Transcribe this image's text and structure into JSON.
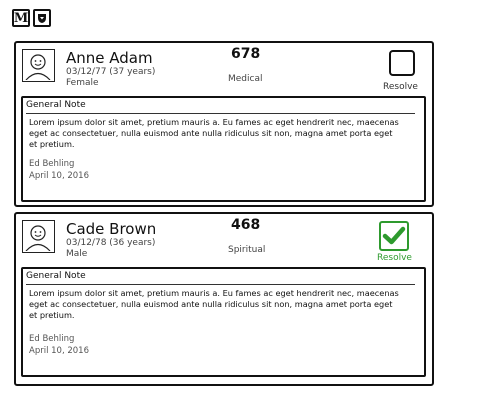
{
  "toolbar": {
    "m_label": "M",
    "icons": [
      "m-logo-icon",
      "shield-down-icon"
    ]
  },
  "patients": [
    {
      "name": "Anne Adam",
      "dob": "03/12/77 (37 years)",
      "gender": "Female",
      "score": "678",
      "category": "Medical",
      "resolve_label": "Resolve",
      "resolved": false,
      "note": {
        "title": "General Note",
        "body": "Lorem ipsum dolor sit amet, pretium mauris a. Eu fames ac eget hendrerit nec, maecenas eget ac consectetuer, nulla euismod ante nulla ridiculus sit non, magna amet porta eget et pretium.",
        "author": "Ed Behling",
        "date": "April 10, 2016"
      }
    },
    {
      "name": "Cade Brown",
      "dob": "03/12/78 (36 years)",
      "gender": "Male",
      "score": "468",
      "category": "Spiritual",
      "resolve_label": "Resolve",
      "resolved": true,
      "note": {
        "title": "General Note",
        "body": "Lorem ipsum dolor sit amet, pretium mauris a. Eu fames ac eget hendrerit nec, maecenas eget ac consectetuer, nulla euismod ante nulla ridiculus sit non, magna amet porta eget et pretium.",
        "author": "Ed Behling",
        "date": "April 10, 2016"
      }
    }
  ],
  "colors": {
    "resolved_accent": "#2e9a2e",
    "border": "#111111"
  }
}
